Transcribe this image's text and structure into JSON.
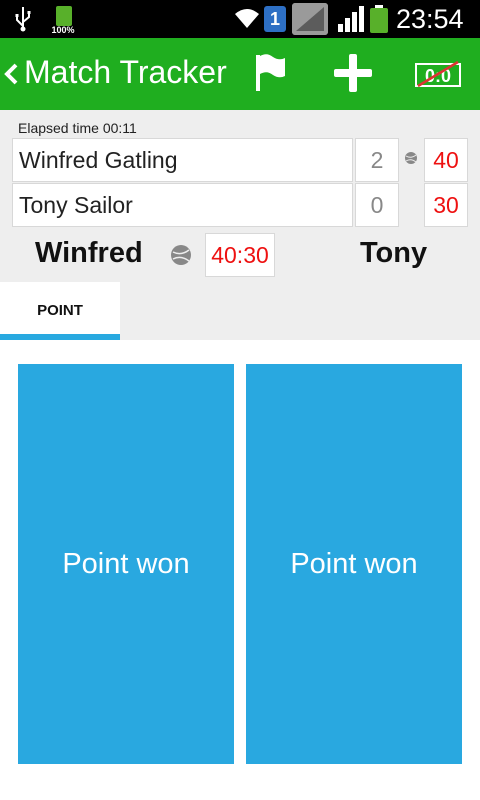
{
  "status_bar": {
    "battery_percent_label": "100%",
    "sim_label": "1",
    "time": "23:54"
  },
  "action_bar": {
    "title": "Match Tracker",
    "icons": [
      "chevron-left-icon",
      "flag-icon",
      "plus-icon",
      "reset-score-icon"
    ],
    "reset_label": "0:0"
  },
  "score": {
    "elapsed_time": "Elapsed time 00:11",
    "players": [
      {
        "name": "Winfred Gatling",
        "games": "2",
        "points": "40",
        "serving": true
      },
      {
        "name": "Tony Sailor",
        "games": "0",
        "points": "30",
        "serving": false
      }
    ],
    "player1_short": "Winfred",
    "player2_short": "Tony",
    "current_score": "40:30"
  },
  "tabs": [
    {
      "label": "POINT",
      "selected": true
    }
  ],
  "buttons": {
    "player1_point": "Point won",
    "player2_point": "Point won"
  },
  "colors": {
    "action_bar": "#1fae1f",
    "accent_blue": "#29a8e0",
    "score_red": "#ee1111",
    "panel_bg": "#eeeeee"
  }
}
